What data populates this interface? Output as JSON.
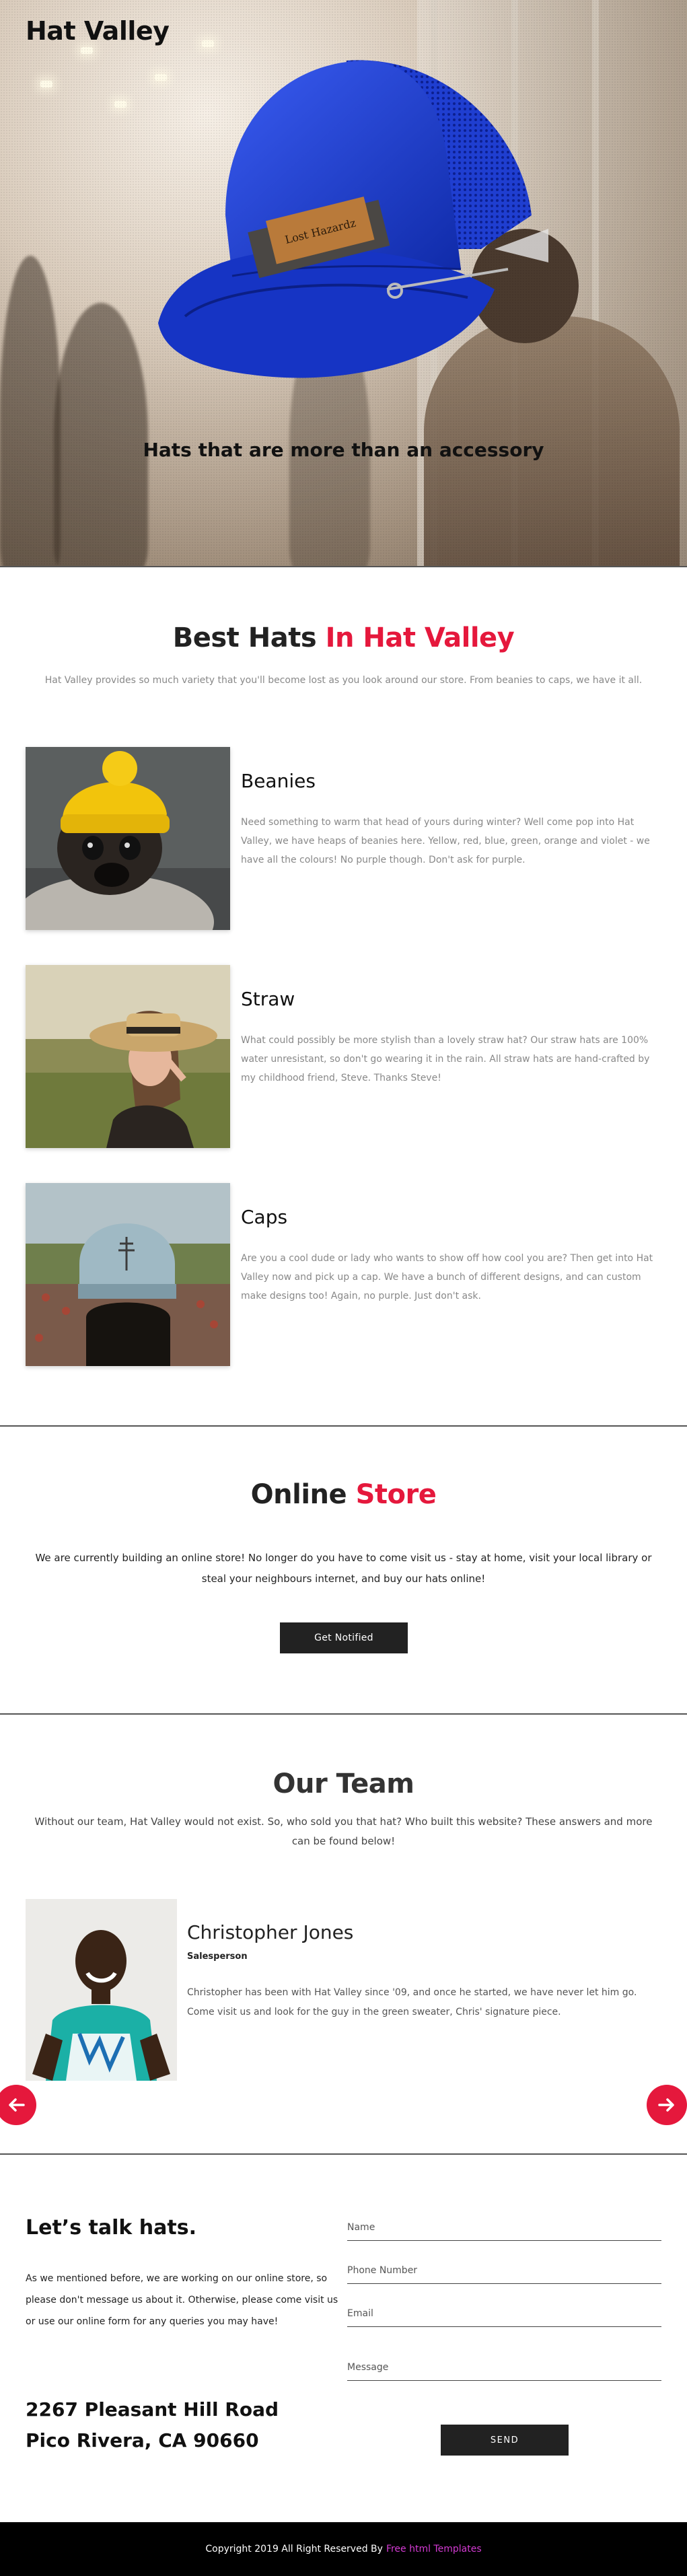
{
  "brand": {
    "logo": "Hat Valley",
    "tagline": "Hats that are more than an accessory"
  },
  "best_hats": {
    "title_main": "Best Hats",
    "title_accent": "In Hat Valley",
    "intro": "Hat Valley provides so much variety that you'll become lost as you look around our store. From beanies to caps, we have it all.",
    "items": [
      {
        "name": "Beanies",
        "description": "Need something to warm that head of yours during winter? Well come pop into Hat Valley, we have heaps of beanies here. Yellow, red, blue, green, orange and violet - we have all the colours! No purple though. Don't ask for purple."
      },
      {
        "name": "Straw",
        "description": "What could possibly be more stylish than a lovely straw hat? Our straw hats are 100% water unresistant, so don't go wearing it in the rain. All straw hats are hand-crafted by my childhood friend, Steve. Thanks Steve!"
      },
      {
        "name": "Caps",
        "description": "Are you a cool dude or lady who wants to show off how cool you are? Then get into Hat Valley now and pick up a cap. We have a bunch of different designs, and can custom make designs too! Again, no purple. Just don't ask."
      }
    ]
  },
  "online_store": {
    "title_main": "Online",
    "title_accent": "Store",
    "text": "We are currently building an online store! No longer do you have to come visit us - stay at home, visit your local library or steal your neighbours internet, and buy our hats online!",
    "button_label": "Get Notified"
  },
  "team": {
    "title": "Our Team",
    "intro": "Without our team, Hat Valley would not exist. So, who sold you that hat? Who built this website? These answers and more can be found below!",
    "member": {
      "name": "Christopher Jones",
      "role": "Salesperson",
      "bio": "Christopher has been with Hat Valley since '09, and once he started, we have never let him go. Come visit us and look for the guy in the green sweater, Chris' signature piece."
    }
  },
  "contact": {
    "title": "Let’s talk hats.",
    "text": "As we mentioned before, we are working on our online store, so please don't message us about it. Otherwise, please come visit us or use our online form for any queries you may have!",
    "address_line1": "2267 Pleasant Hill Road",
    "address_line2": "Pico Rivera, CA 90660",
    "form": {
      "name_placeholder": "Name",
      "phone_placeholder": "Phone Number",
      "email_placeholder": "Email",
      "message_placeholder": "Message",
      "send_label": "SEND"
    }
  },
  "footer": {
    "copyright": "Copyright 2019 All Right Reserved By",
    "link_text": "Free html Templates"
  },
  "colors": {
    "accent": "#e5183c",
    "button": "#222222",
    "footer_link": "#d43bd3",
    "cap_blue": "#1d3fd6"
  },
  "icons": {
    "prev": "arrow-left-icon",
    "next": "arrow-right-icon"
  }
}
